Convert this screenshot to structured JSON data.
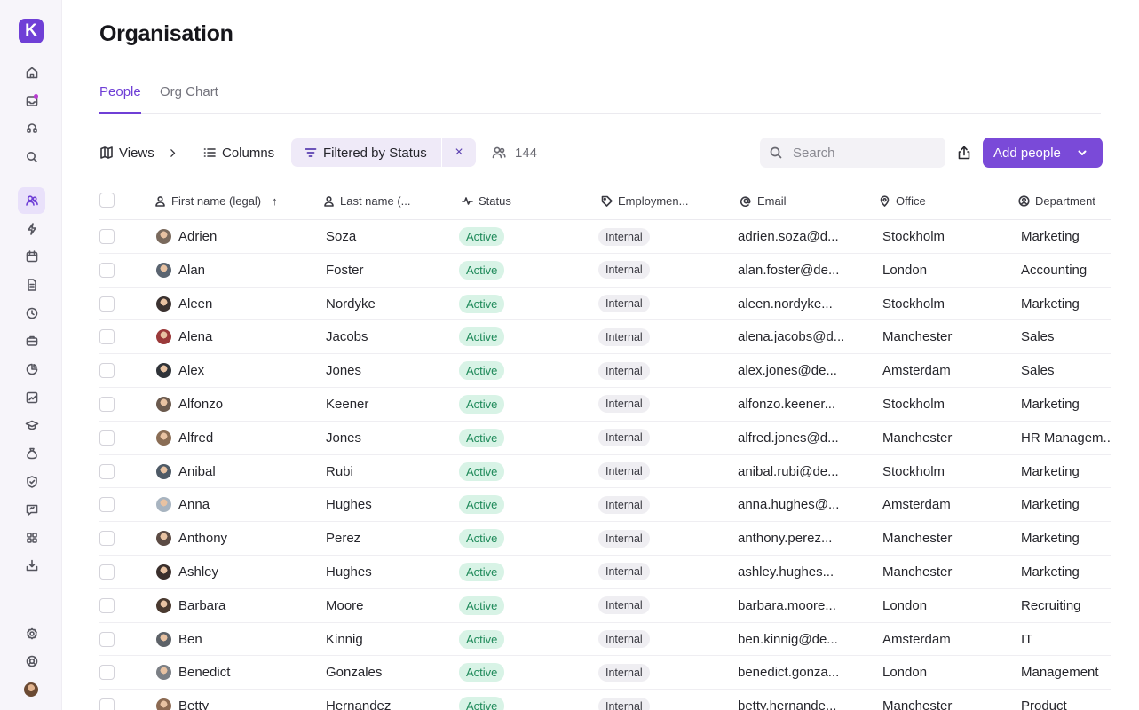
{
  "app": {
    "logo_letter": "K"
  },
  "sidebar": {
    "items": [
      {
        "icon": "home-icon"
      },
      {
        "icon": "inbox-icon",
        "dot": true
      },
      {
        "icon": "support-icon"
      },
      {
        "icon": "search-icon"
      },
      {
        "icon": "people-icon",
        "active": true
      },
      {
        "icon": "lightning-icon"
      },
      {
        "icon": "calendar-icon"
      },
      {
        "icon": "document-icon"
      },
      {
        "icon": "clock-icon"
      },
      {
        "icon": "briefcase-icon"
      },
      {
        "icon": "chart-icon"
      },
      {
        "icon": "performance-icon"
      },
      {
        "icon": "graduation-icon"
      },
      {
        "icon": "money-bag-icon"
      },
      {
        "icon": "shield-icon"
      },
      {
        "icon": "feedback-icon"
      },
      {
        "icon": "apps-icon"
      },
      {
        "icon": "download-icon"
      }
    ],
    "bottom": [
      {
        "icon": "settings-icon"
      },
      {
        "icon": "help-icon"
      },
      {
        "icon": "avatar"
      }
    ]
  },
  "page": {
    "title": "Organisation",
    "tabs": [
      {
        "label": "People",
        "active": true
      },
      {
        "label": "Org Chart",
        "active": false
      }
    ]
  },
  "toolbar": {
    "views_label": "Views",
    "columns_label": "Columns",
    "filter_label": "Filtered by Status",
    "filter_clear": "×",
    "count": "144",
    "search_placeholder": "Search",
    "add_label": "Add people"
  },
  "table": {
    "columns": [
      "First name (legal)",
      "Last name (...",
      "Status",
      "Employmen...",
      "Email",
      "Office",
      "Department"
    ],
    "sort_indicator": "↑",
    "rows": [
      {
        "first": "Adrien",
        "last": "Soza",
        "status": "Active",
        "employment": "Internal",
        "email": "adrien.soza@d...",
        "office": "Stockholm",
        "department": "Marketing",
        "avatar_color": "#7a6a5d"
      },
      {
        "first": "Alan",
        "last": "Foster",
        "status": "Active",
        "employment": "Internal",
        "email": "alan.foster@de...",
        "office": "London",
        "department": "Accounting",
        "avatar_color": "#5a6470"
      },
      {
        "first": "Aleen",
        "last": "Nordyke",
        "status": "Active",
        "employment": "Internal",
        "email": "aleen.nordyke...",
        "office": "Stockholm",
        "department": "Marketing",
        "avatar_color": "#3b3230"
      },
      {
        "first": "Alena",
        "last": "Jacobs",
        "status": "Active",
        "employment": "Internal",
        "email": "alena.jacobs@d...",
        "office": "Manchester",
        "department": "Sales",
        "avatar_color": "#9b3a3a"
      },
      {
        "first": "Alex",
        "last": "Jones",
        "status": "Active",
        "employment": "Internal",
        "email": "alex.jones@de...",
        "office": "Amsterdam",
        "department": "Sales",
        "avatar_color": "#2f3338"
      },
      {
        "first": "Alfonzo",
        "last": "Keener",
        "status": "Active",
        "employment": "Internal",
        "email": "alfonzo.keener...",
        "office": "Stockholm",
        "department": "Marketing",
        "avatar_color": "#6b5a4e"
      },
      {
        "first": "Alfred",
        "last": "Jones",
        "status": "Active",
        "employment": "Internal",
        "email": "alfred.jones@d...",
        "office": "Manchester",
        "department": "HR Managem...",
        "avatar_color": "#8a6d55"
      },
      {
        "first": "Anibal",
        "last": "Rubi",
        "status": "Active",
        "employment": "Internal",
        "email": "anibal.rubi@de...",
        "office": "Stockholm",
        "department": "Marketing",
        "avatar_color": "#4e5a66"
      },
      {
        "first": "Anna",
        "last": "Hughes",
        "status": "Active",
        "employment": "Internal",
        "email": "anna.hughes@...",
        "office": "Amsterdam",
        "department": "Marketing",
        "avatar_color": "#a8b4c0"
      },
      {
        "first": "Anthony",
        "last": "Perez",
        "status": "Active",
        "employment": "Internal",
        "email": "anthony.perez...",
        "office": "Manchester",
        "department": "Marketing",
        "avatar_color": "#5c4b44"
      },
      {
        "first": "Ashley",
        "last": "Hughes",
        "status": "Active",
        "employment": "Internal",
        "email": "ashley.hughes...",
        "office": "Manchester",
        "department": "Marketing",
        "avatar_color": "#3a2f2c"
      },
      {
        "first": "Barbara",
        "last": "Moore",
        "status": "Active",
        "employment": "Internal",
        "email": "barbara.moore...",
        "office": "London",
        "department": "Recruiting",
        "avatar_color": "#4a3a30"
      },
      {
        "first": "Ben",
        "last": "Kinnig",
        "status": "Active",
        "employment": "Internal",
        "email": "ben.kinnig@de...",
        "office": "Amsterdam",
        "department": "IT",
        "avatar_color": "#5d6268"
      },
      {
        "first": "Benedict",
        "last": "Gonzales",
        "status": "Active",
        "employment": "Internal",
        "email": "benedict.gonza...",
        "office": "London",
        "department": "Management",
        "avatar_color": "#7b7f85"
      },
      {
        "first": "Betty",
        "last": "Hernandez",
        "status": "Active",
        "employment": "Internal",
        "email": "betty.hernande...",
        "office": "Manchester",
        "department": "Product",
        "avatar_color": "#8c6a52"
      }
    ]
  }
}
